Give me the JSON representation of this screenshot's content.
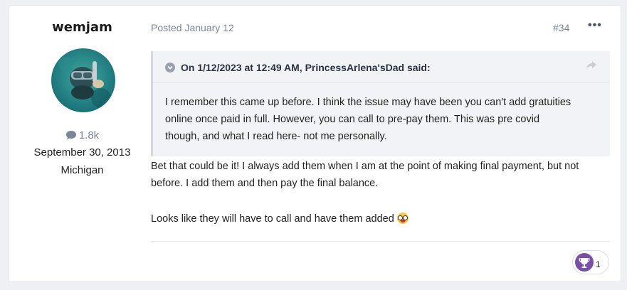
{
  "author": {
    "name": "wemjam",
    "post_count": "1.8k",
    "joined": "September 30, 2013",
    "location": "Michigan"
  },
  "post": {
    "posted": "Posted January 12",
    "number": "#34",
    "more_label": "•••"
  },
  "quote": {
    "citation": "On 1/12/2023 at 12:49 AM, PrincessArlena'sDad said:",
    "lines": [
      "I remember this came up before. I think the issue may have been you can't add gratuities",
      "online once paid in full. However, you can call to pre-pay them.  This was pre covid",
      "though, and what I read here- not me personally."
    ]
  },
  "reply": {
    "lines": [
      "Bet that could be it!  I always add them when I am at the point of making final payment, but not",
      "before.  I add them and then pay the final balance."
    ],
    "closing": "Looks like they will have to call and have them added"
  },
  "reaction": {
    "icon": "trophy-icon",
    "count": "1"
  },
  "colors": {
    "muted": "#7c8696",
    "quote_bg": "#f2f3f6",
    "reaction_icon": "#7a4fa6"
  }
}
